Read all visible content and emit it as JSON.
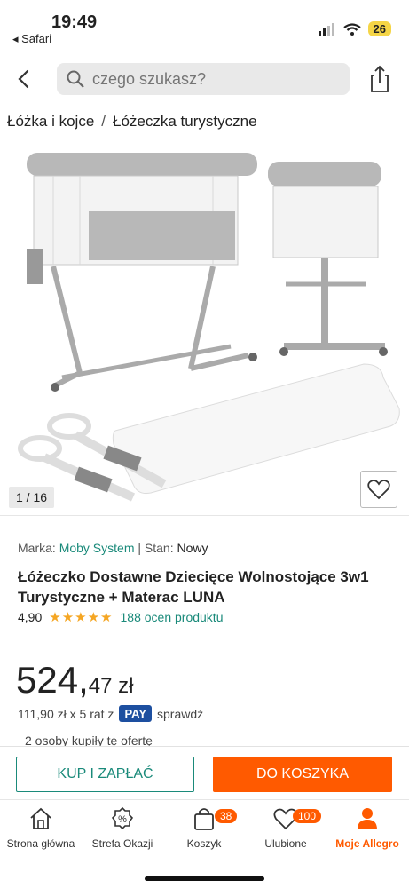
{
  "status_bar": {
    "time": "19:49",
    "back_app": "◂ Safari",
    "battery": "26"
  },
  "search": {
    "placeholder": "czego szukasz?"
  },
  "breadcrumb": {
    "items": [
      "Łóżka i kojce",
      "Łóżeczka turystyczne"
    ],
    "separator": "/"
  },
  "gallery": {
    "counter": "1 / 16"
  },
  "product": {
    "brand_label": "Marka:",
    "brand": "Moby System",
    "condition_label": "Stan:",
    "condition": "Nowy",
    "title": "Łóżeczko Dostawne Dziecięce Wolnostojące 3w1 Turystyczne + Materac LUNA",
    "rating": "4,90",
    "stars": 5,
    "reviews": "188 ocen produktu",
    "price_main": "524,",
    "price_decimal": "47 zł",
    "installment_text": "111,90 zł x 5 rat z",
    "pay_badge": "PAY",
    "installment_link": "sprawdź",
    "bought": "2 osoby kupiły tę ofertę"
  },
  "actions": {
    "buy": "KUP I ZAPŁAĆ",
    "cart": "DO KOSZYKA"
  },
  "tabbar": {
    "items": [
      {
        "label": "Strona główna",
        "icon": "home-icon"
      },
      {
        "label": "Strefa Okazji",
        "icon": "percent-tag-icon"
      },
      {
        "label": "Koszyk",
        "icon": "bag-icon",
        "badge": "38"
      },
      {
        "label": "Ulubione",
        "icon": "heart-icon",
        "badge": "100"
      },
      {
        "label": "Moje Allegro",
        "icon": "person-icon"
      }
    ]
  },
  "colors": {
    "accent": "#ff5a00",
    "link": "#1a8a7a",
    "pay": "#1d4fa0",
    "star": "#f5a623"
  }
}
